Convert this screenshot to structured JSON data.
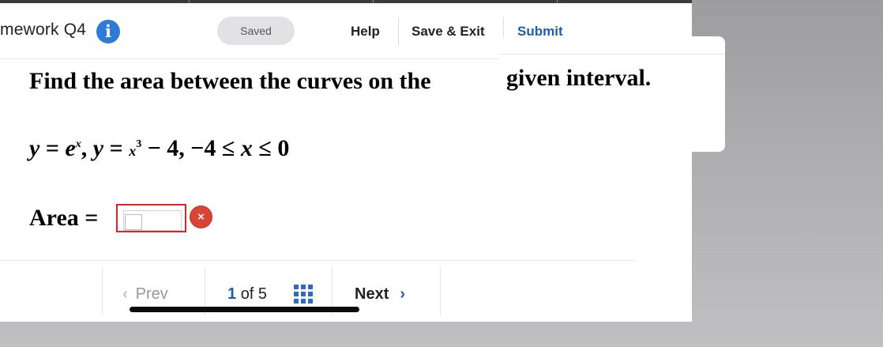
{
  "header": {
    "title": "mework Q4",
    "info_icon": "i",
    "saved_label": "Saved",
    "help_label": "Help",
    "save_exit_label": "Save & Exit",
    "submit_label": "Submit"
  },
  "question": {
    "prompt_part1": "Find the area between the curves on the",
    "prompt_part2": "given interval.",
    "equation": {
      "y1": "y",
      "eq1": " = ",
      "e_base": "e",
      "e_exp": "x",
      "sep": ", ",
      "y2": "y",
      "eq2": " = ",
      "x_base": "x",
      "x_exp": "3",
      "minus_four": " − 4, −4 ≤ ",
      "x_var": "x",
      "leq_zero": " ≤ 0"
    },
    "answer_label": "Area =",
    "answer_value": "",
    "error_glyph": "×"
  },
  "navigation": {
    "prev_label": "Prev",
    "prev_chevron": "‹",
    "page_current": "1",
    "page_of": "of 5",
    "next_label": "Next",
    "next_chevron": "›"
  },
  "colors": {
    "accent": "#1e5fa8",
    "error": "#d94535",
    "info": "#2e7bd6"
  },
  "icons": [
    "info-icon",
    "error-icon",
    "grid-icon",
    "chevron-left-icon",
    "chevron-right-icon"
  ]
}
